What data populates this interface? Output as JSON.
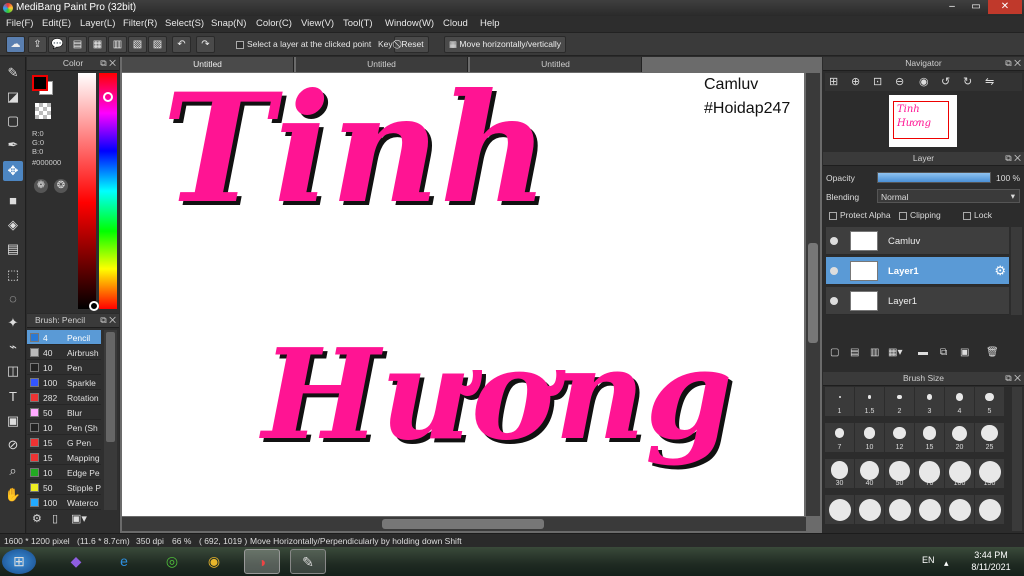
{
  "window": {
    "title": "MediBang Paint Pro (32bit)"
  },
  "menu": [
    "File(F)",
    "Edit(E)",
    "Layer(L)",
    "Filter(R)",
    "Select(S)",
    "Snap(N)",
    "Color(C)",
    "View(V)",
    "Tool(T)",
    "Window(W)",
    "Cloud",
    "Help"
  ],
  "toolbar": {
    "select_layer_label": "Select a layer at the clicked point",
    "key_label": "Key",
    "reset_label": "Reset",
    "move_label": "Move horizontally/vertically"
  },
  "color_panel": {
    "title": "Color",
    "r": "R:0",
    "g": "G:0",
    "b": "B:0",
    "hex": "#000000",
    "primary": "#000000",
    "secondary": "#ffffff",
    "bar_color": "#ff0000"
  },
  "brush_panel": {
    "title": "Brush: Pencil",
    "items": [
      {
        "size": "4",
        "name": "Pencil",
        "color": "#2a7ad6"
      },
      {
        "size": "40",
        "name": "Airbrush",
        "color": "#bbbbbb"
      },
      {
        "size": "10",
        "name": "Pen",
        "color": "#222222"
      },
      {
        "size": "100",
        "name": "Sparkle",
        "color": "#3355ff"
      },
      {
        "size": "282",
        "name": "Rotation",
        "color": "#ee3333"
      },
      {
        "size": "50",
        "name": "Blur",
        "color": "#ffaaff"
      },
      {
        "size": "10",
        "name": "Pen (Sh",
        "color": "#222222"
      },
      {
        "size": "15",
        "name": "G Pen",
        "color": "#ee3333"
      },
      {
        "size": "15",
        "name": "Mapping",
        "color": "#ee3333"
      },
      {
        "size": "10",
        "name": "Edge Pe",
        "color": "#22aa22"
      },
      {
        "size": "50",
        "name": "Stipple P",
        "color": "#eeee22"
      },
      {
        "size": "100",
        "name": "Waterco",
        "color": "#22aaff"
      }
    ]
  },
  "tabs": [
    "Untitled",
    "Untitled",
    "Untitled"
  ],
  "canvas": {
    "watermark_line1": "Camluv",
    "watermark_line2": "#Hoidap247",
    "text_line1": "Tinh",
    "text_line2": "Hương",
    "text_color": "#ff1493"
  },
  "navigator": {
    "title": "Navigator"
  },
  "layer_panel": {
    "title": "Layer",
    "opacity_label": "Opacity",
    "opacity_value": "100 %",
    "opacity": 1.0,
    "blending_label": "Blending",
    "blending_value": "Normal",
    "protect_alpha": "Protect Alpha",
    "clipping": "Clipping",
    "lock": "Lock",
    "layers": [
      "Camluv",
      "Layer1",
      "Layer1"
    ]
  },
  "brush_size": {
    "title": "Brush Size",
    "sizes": [
      "1",
      "1.5",
      "2",
      "3",
      "4",
      "5",
      "7",
      "10",
      "12",
      "15",
      "20",
      "25",
      "30",
      "40",
      "50",
      "70",
      "100",
      "150"
    ]
  },
  "status": {
    "dimensions": "1600 * 1200 pixel",
    "physical": "(11.6 * 8.7cm)",
    "dpi": "350 dpi",
    "zoom": "66 %",
    "coords": "( 692, 1019 )",
    "hint": "Move Horizontally/Perpendicularly by holding down Shift"
  },
  "taskbar": {
    "lang": "EN",
    "time": "3:44 PM",
    "date": "8/11/2021"
  }
}
